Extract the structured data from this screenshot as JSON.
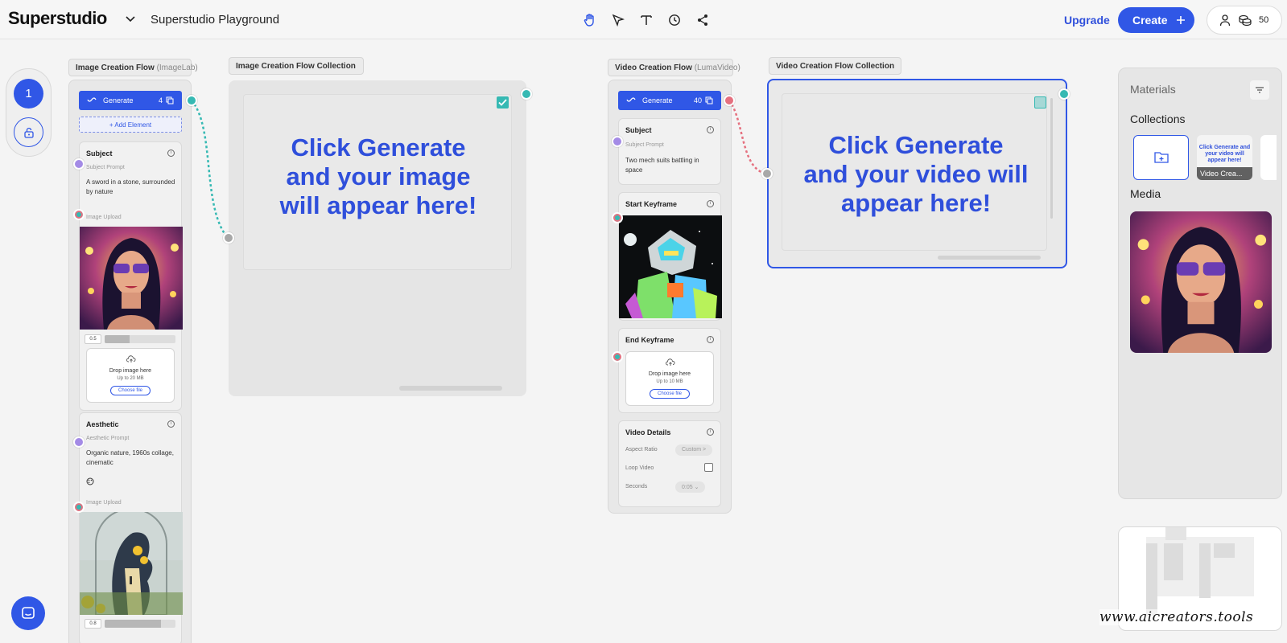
{
  "header": {
    "brand": "Superstudio",
    "project_title": "Superstudio Playground",
    "tools": [
      "hand-icon",
      "pointer-icon",
      "text-icon",
      "clock-icon",
      "share-icon"
    ],
    "upgrade_label": "Upgrade",
    "create_label": "Create",
    "credits": "50"
  },
  "step": {
    "number": "1"
  },
  "image_flow": {
    "label": "Image Creation Flow",
    "label_sub": "(ImageLab)",
    "generate_label": "Generate",
    "generate_count": "4",
    "add_element_label": "+ Add Element",
    "subject": {
      "title": "Subject",
      "prompt_label": "Subject Prompt",
      "prompt_value": "A sword in a stone, surrounded by nature",
      "upload_label": "Image Upload",
      "slider_value": "0.5",
      "slider_fraction": 0.35,
      "drop_text": "Drop image here",
      "drop_limit": "Up to 20 MB",
      "choose_label": "Choose file"
    },
    "aesthetic": {
      "title": "Aesthetic",
      "prompt_label": "Aesthetic Prompt",
      "prompt_value": "Organic nature, 1960s collage, cinematic",
      "upload_label": "Image Upload",
      "slider_value": "0.8",
      "slider_fraction": 0.8
    }
  },
  "image_collection": {
    "label": "Image Creation Flow Collection",
    "message": "Click Generate and your image will appear here!"
  },
  "video_flow": {
    "label": "Video Creation Flow",
    "label_sub": "(LumaVideo)",
    "generate_label": "Generate",
    "generate_count": "40",
    "subject": {
      "title": "Subject",
      "prompt_label": "Subject Prompt",
      "prompt_value": "Two mech suits battling in space"
    },
    "start_keyframe": {
      "title": "Start Keyframe"
    },
    "end_keyframe": {
      "title": "End Keyframe",
      "drop_text": "Drop image here",
      "drop_limit": "Up to 10 MB",
      "choose_label": "Choose file"
    },
    "details": {
      "title": "Video Details",
      "aspect_ratio_label": "Aspect Ratio",
      "aspect_ratio_value": "Custom >",
      "loop_label": "Loop Video",
      "loop_checked": false,
      "seconds_label": "Seconds",
      "seconds_value": "0:05 ⌄"
    }
  },
  "video_collection": {
    "label": "Video Creation Flow Collection",
    "message": "Click Generate and your video will appear here!"
  },
  "materials": {
    "title": "Materials",
    "collections_heading": "Collections",
    "collection_thumb_text": "Click Generate and your video will appear here!",
    "collection_thumb_caption": "Video Crea...",
    "media_heading": "Media"
  },
  "watermark": "www.aicreators.tools",
  "colors": {
    "accent": "#3057e6",
    "teal_port": "#36b9b3",
    "purple_port": "#a48be6",
    "red_port": "#e5707f",
    "grey_port": "#a8a8a8"
  }
}
